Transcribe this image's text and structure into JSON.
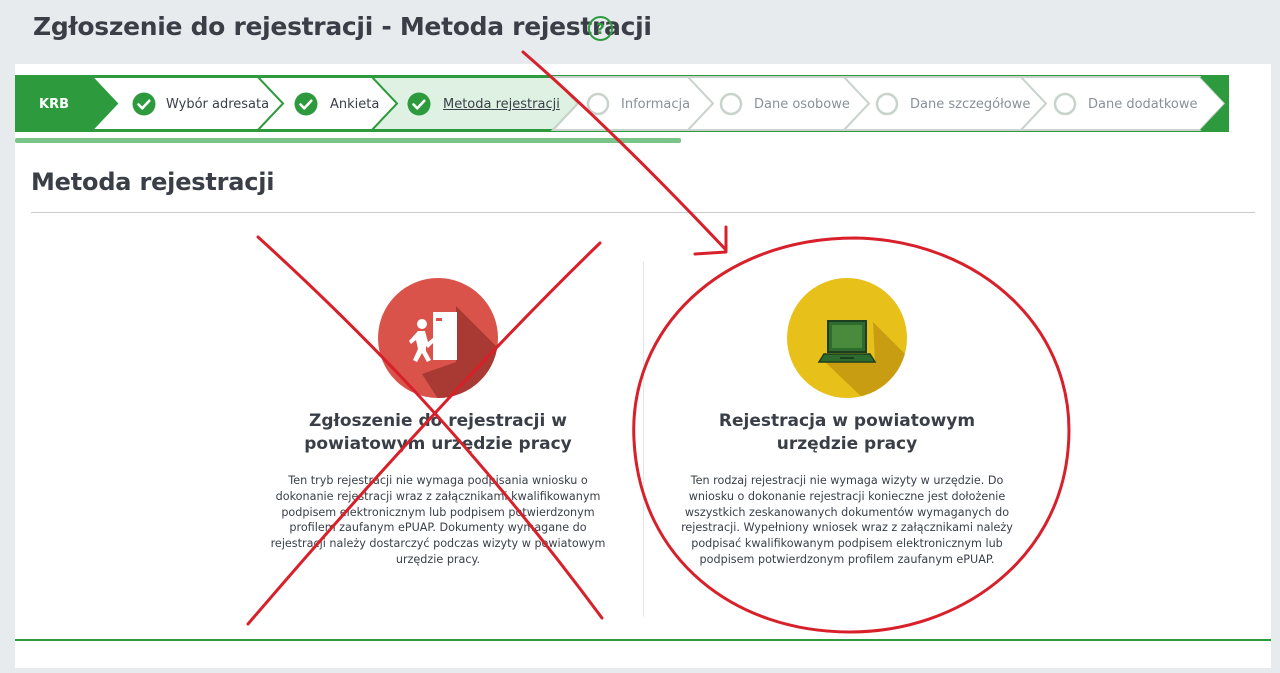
{
  "page": {
    "title": "Zgłoszenie do rejestracji - Metoda rejestracji",
    "help_icon": "question-circle-icon",
    "help_glyph": "?"
  },
  "stepper": {
    "steps": [
      {
        "label": "KRB",
        "state": "start"
      },
      {
        "label": "Wybór adresata",
        "state": "done"
      },
      {
        "label": "Ankieta",
        "state": "done"
      },
      {
        "label": "Metoda rejestracji",
        "state": "current"
      },
      {
        "label": "Informacja",
        "state": "pending"
      },
      {
        "label": "Dane osobowe",
        "state": "pending"
      },
      {
        "label": "Dane szczegółowe",
        "state": "pending"
      },
      {
        "label": "Dane dodatkowe",
        "state": "pending"
      }
    ],
    "progress": 0.53
  },
  "section": {
    "title": "Metoda rejestracji"
  },
  "options": [
    {
      "title": "Zgłoszenie do rejestracji w powiatowym urzędzie pracy",
      "description": "Ten tryb rejestracji nie wymaga podpisania wniosku o dokonanie rejestracji wraz z załącznikami kwalifikowanym podpisem elektronicznym lub podpisem potwierdzonym profilem zaufanym ePUAP. Dokumenty wymagane do rejestracji należy dostarczyć podczas wizyty w powiatowym urzędzie pracy.",
      "icon": "person-entering-door-icon",
      "icon_color": "#d9534a",
      "annotation": "crossed-out"
    },
    {
      "title": "Rejestracja w powiatowym urzędzie pracy",
      "description": "Ten rodzaj rejestracji nie wymaga wizyty w urzędzie. Do wniosku o dokonanie rejestracji konieczne jest dołożenie wszystkich zeskanowanych dokumentów wymaganych do rejestracji. Wypełniony wniosek wraz z załącznikami należy podpisać kwalifikowanym podpisem elektronicznym lub podpisem potwierdzonym profilem zaufanym ePUAP.",
      "icon": "laptop-icon",
      "icon_color": "#e8c01a",
      "annotation": "circled"
    }
  ],
  "colors": {
    "brand_green": "#2e9a3e",
    "current_step_bg": "#dff1e2",
    "pending_text": "#8a9097",
    "annotation_red": "#d8202a"
  }
}
